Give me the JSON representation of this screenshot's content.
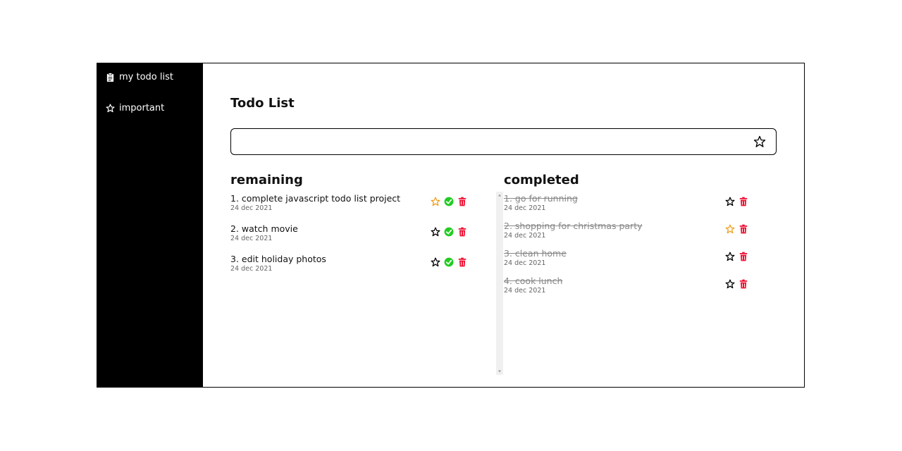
{
  "sidebar": {
    "items": [
      {
        "label": "my todo list",
        "icon": "clipboard-icon"
      },
      {
        "label": "important",
        "icon": "star-icon"
      }
    ]
  },
  "main": {
    "title": "Todo List",
    "input": {
      "value": "",
      "placeholder": ""
    }
  },
  "remaining": {
    "heading": "remaining",
    "items": [
      {
        "text": "1. complete javascript todo list project",
        "date": "24 dec 2021",
        "important": true
      },
      {
        "text": "2. watch movie",
        "date": "24 dec 2021",
        "important": false
      },
      {
        "text": "3. edit holiday photos",
        "date": "24 dec 2021",
        "important": false
      }
    ]
  },
  "completed": {
    "heading": "completed",
    "items": [
      {
        "text": "1. go for running",
        "date": "24 dec 2021",
        "important": false
      },
      {
        "text": "2. shopping for christmas party",
        "date": "24 dec 2021",
        "important": true
      },
      {
        "text": "3. clean home",
        "date": "24 dec 2021",
        "important": false
      },
      {
        "text": "4. cook lunch",
        "date": "24 dec 2021",
        "important": false
      }
    ]
  },
  "colors": {
    "sidebar_bg": "#000000",
    "important_star": "#f0a020",
    "check": "#22cc22",
    "trash": "#ee1133"
  }
}
